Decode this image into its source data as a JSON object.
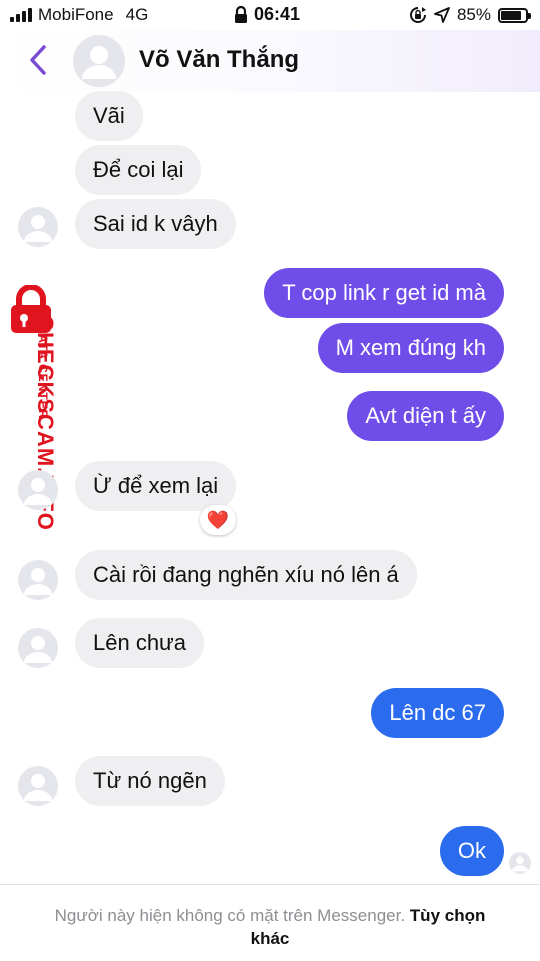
{
  "status_bar": {
    "carrier": "MobiFone",
    "network": "4G",
    "time": "06:41",
    "battery": "85%",
    "battery_level": 0.85,
    "icons": [
      "signal-icon",
      "lock-icon",
      "screen-rotation-lock-icon",
      "location-arrow-icon",
      "battery-icon"
    ]
  },
  "header": {
    "back_icon": "chevron-left-icon",
    "contact_name": "Võ Văn Thắng",
    "accent_color": "#7b4bd6"
  },
  "messages": [
    {
      "sender": "contact",
      "text": "Vãi"
    },
    {
      "sender": "contact",
      "text": "Để coi lại"
    },
    {
      "sender": "contact",
      "text": "Sai id k vâyh"
    },
    {
      "sender": "me",
      "text": "T cop link r get id mà"
    },
    {
      "sender": "me",
      "text": "M xem đúng kh"
    },
    {
      "sender": "me",
      "text": "Avt diện t ấy"
    },
    {
      "sender": "contact",
      "text": "Ừ để xem lại",
      "reaction": "❤️"
    },
    {
      "sender": "contact",
      "text": "Cài rồi đang nghẽn xíu nó lên á"
    },
    {
      "sender": "contact",
      "text": "Lên chưa"
    },
    {
      "sender": "me",
      "text": "Lên dc 67"
    },
    {
      "sender": "contact",
      "text": "Từ nó ngẽn"
    },
    {
      "sender": "me",
      "text": "Ok",
      "seen_avatar": true
    }
  ],
  "watermark": {
    "brand": "CHECKSCAM.INFO",
    "subtitle": "DATA CENTER",
    "color": "#e0141f"
  },
  "footer": {
    "text": "Người này hiện không có mặt trên Messenger.",
    "link": "Tùy chọn khác"
  },
  "colors": {
    "outgoing_purple": "#6f4de8",
    "outgoing_blue": "#2b6bee",
    "incoming": "#efeff1"
  }
}
